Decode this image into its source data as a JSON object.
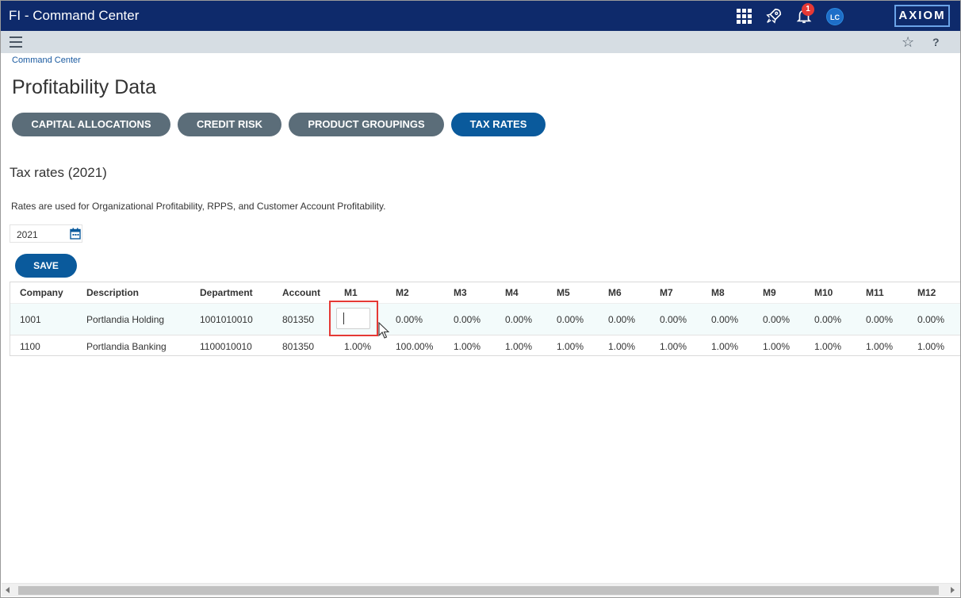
{
  "window": {
    "title": "FI - Command Center"
  },
  "topbar": {
    "icons": [
      "apps-grid-icon",
      "rocket-icon",
      "bell-icon",
      "avatar"
    ],
    "notification_count": "1",
    "user_initials": "LC",
    "logo_text": "AXIOM",
    "colors": {
      "bar": "#0e2a6b",
      "badge": "#e53935",
      "avatar": "#1e6ec8"
    }
  },
  "subbar": {
    "icons": [
      "hamburger-menu-icon",
      "star-icon",
      "help-icon"
    ],
    "help_glyph": "?",
    "star_glyph": "☆"
  },
  "breadcrumb": "Command Center",
  "page_title": "Profitability Data",
  "tabs": [
    {
      "label": "CAPITAL ALLOCATIONS",
      "active": false
    },
    {
      "label": "CREDIT RISK",
      "active": false
    },
    {
      "label": "PRODUCT GROUPINGS",
      "active": false
    },
    {
      "label": "TAX RATES",
      "active": true
    }
  ],
  "section_title": "Tax rates (2021)",
  "info_text": "Rates are used for Organizational Profitability, RPPS, and Customer Account Profitability.",
  "year_picker": {
    "value": "2021",
    "icon": "calendar-icon"
  },
  "save_label": "SAVE",
  "table": {
    "columns": [
      "Company",
      "Description",
      "Department",
      "Account",
      "M1",
      "M2",
      "M3",
      "M4",
      "M5",
      "M6",
      "M7",
      "M8",
      "M9",
      "M10",
      "M11",
      "M12"
    ],
    "rows": [
      [
        "1001",
        "Portlandia Holding",
        "1001010010",
        "801350",
        "",
        "0.00%",
        "0.00%",
        "0.00%",
        "0.00%",
        "0.00%",
        "0.00%",
        "0.00%",
        "0.00%",
        "0.00%",
        "0.00%",
        "0.00%"
      ],
      [
        "1100",
        "Portlandia Banking",
        "1100010010",
        "801350",
        "1.00%",
        "100.00%",
        "1.00%",
        "1.00%",
        "1.00%",
        "1.00%",
        "1.00%",
        "1.00%",
        "1.00%",
        "1.00%",
        "1.00%",
        "1.00%"
      ]
    ],
    "editing_cell": {
      "row": 0,
      "column": "M1",
      "value": ""
    }
  },
  "colors": {
    "accent": "#0a5a9c",
    "tab_inactive": "#5b6d79",
    "highlight": "#e53935"
  }
}
